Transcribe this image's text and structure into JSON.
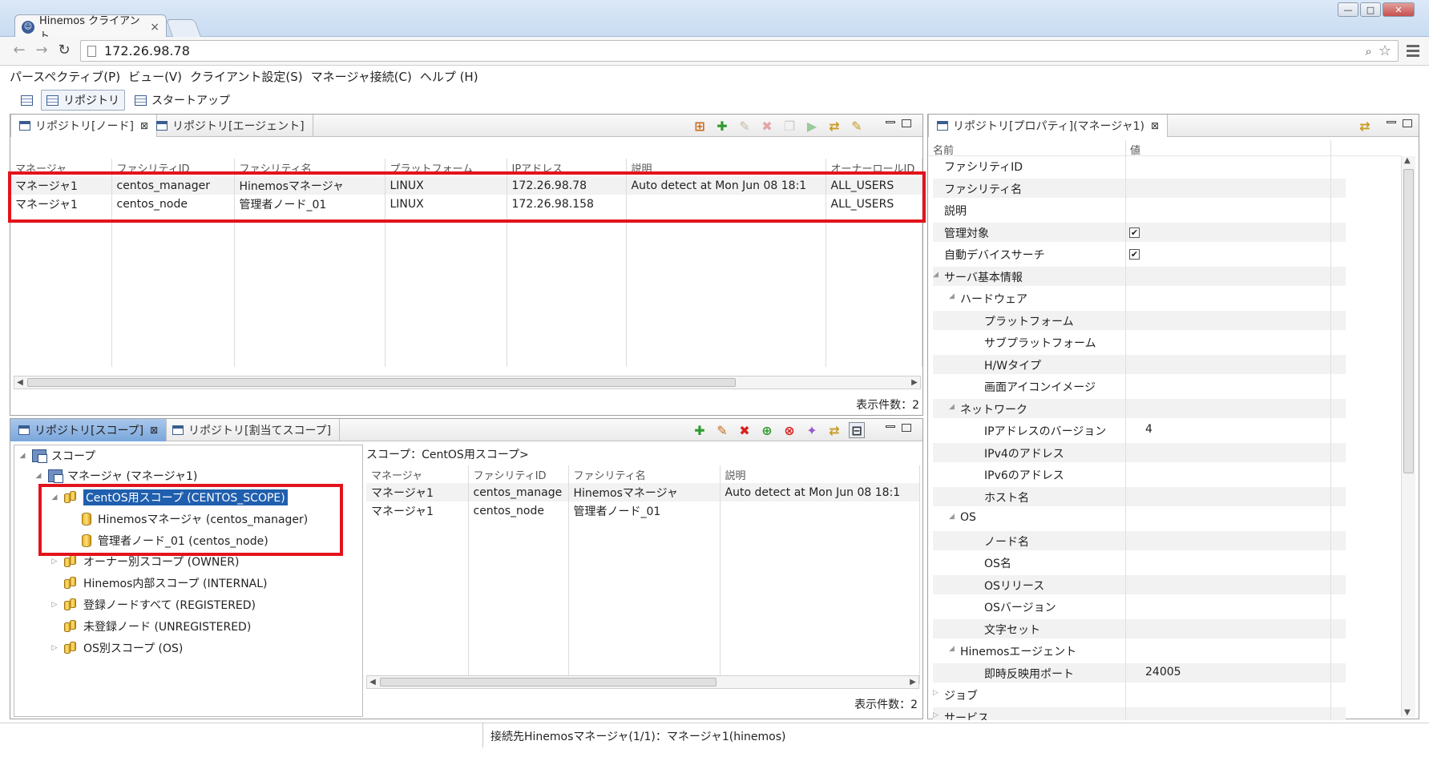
{
  "browser": {
    "tab_title": "Hinemos クライアント",
    "tab_close": "×",
    "url": "172.26.98.78",
    "window_buttons": [
      "—",
      "□",
      "✕"
    ]
  },
  "menu": [
    "パースペクティブ(P)",
    "ビュー(V)",
    "クライアント設定(S)",
    "マネージャ接続(C)",
    "ヘルプ (H)"
  ],
  "perspectives": {
    "items": [
      "リポジトリ",
      "スタートアップ"
    ]
  },
  "node_view": {
    "tabs": [
      "リポジトリ[ノード]",
      "リポジトリ[エージェント]"
    ],
    "columns": [
      "マネージャ",
      "ファシリティID",
      "ファシリティ名",
      "プラットフォーム",
      "IPアドレス",
      "説明",
      "オーナーロールID"
    ],
    "rows": [
      [
        "マネージャ1",
        "centos_manager",
        "Hinemosマネージャ",
        "LINUX",
        "172.26.98.78",
        "Auto detect at Mon Jun 08 18:1",
        "ALL_USERS"
      ],
      [
        "マネージャ1",
        "centos_node",
        "管理者ノード_01",
        "LINUX",
        "172.26.98.158",
        "",
        "ALL_USERS"
      ]
    ],
    "count_label": "表示件数：2"
  },
  "scope_view": {
    "tabs": [
      "リポジトリ[スコープ]",
      "リポジトリ[割当てスコープ]"
    ],
    "tree": {
      "root": "スコープ",
      "manager": "マネージャ (マネージャ1)",
      "selected": "CentOS用スコープ (CENTOS_SCOPE)",
      "children": [
        "Hinemosマネージャ (centos_manager)",
        "管理者ノード_01 (centos_node)"
      ],
      "others": [
        "オーナー別スコープ (OWNER)",
        "Hinemos内部スコープ (INTERNAL)",
        "登録ノードすべて (REGISTERED)",
        "未登録ノード (UNREGISTERED)",
        "OS別スコープ (OS)"
      ]
    },
    "detail_title": "スコープ：CentOS用スコープ>",
    "columns": [
      "マネージャ",
      "ファシリティID",
      "ファシリティ名",
      "説明"
    ],
    "rows": [
      [
        "マネージャ1",
        "centos_manage",
        "Hinemosマネージャ",
        "Auto detect at Mon Jun 08 18:1"
      ],
      [
        "マネージャ1",
        "centos_node",
        "管理者ノード_01",
        ""
      ]
    ],
    "count_label": "表示件数：2"
  },
  "property_view": {
    "tab": "リポジトリ[プロパティ](マネージャ1)",
    "col_name": "名前",
    "col_value": "値",
    "rows": [
      {
        "name": "ファシリティID",
        "value": "",
        "indent": 0
      },
      {
        "name": "ファシリティ名",
        "value": "",
        "indent": 0
      },
      {
        "name": "説明",
        "value": "",
        "indent": 0
      },
      {
        "name": "管理対象",
        "value": "✔",
        "indent": 0,
        "check": true
      },
      {
        "name": "自動デバイスサーチ",
        "value": "✔",
        "indent": 0,
        "check": true
      },
      {
        "name": "サーバ基本情報",
        "value": "",
        "indent": 0,
        "expand": true
      },
      {
        "name": "ハードウェア",
        "value": "",
        "indent": 1,
        "expand": true
      },
      {
        "name": "プラットフォーム",
        "value": "",
        "indent": 2
      },
      {
        "name": "サブプラットフォーム",
        "value": "",
        "indent": 2
      },
      {
        "name": "H/Wタイプ",
        "value": "",
        "indent": 2
      },
      {
        "name": "画面アイコンイメージ",
        "value": "",
        "indent": 2
      },
      {
        "name": "ネットワーク",
        "value": "",
        "indent": 1,
        "expand": true
      },
      {
        "name": "IPアドレスのバージョン",
        "value": "4",
        "indent": 2
      },
      {
        "name": "IPv4のアドレス",
        "value": "",
        "indent": 2
      },
      {
        "name": "IPv6のアドレス",
        "value": "",
        "indent": 2
      },
      {
        "name": "ホスト名",
        "value": "",
        "indent": 2
      },
      {
        "name": "OS",
        "value": "",
        "indent": 1,
        "expand": true
      },
      {
        "name": "ノード名",
        "value": "",
        "indent": 2
      },
      {
        "name": "OS名",
        "value": "",
        "indent": 2
      },
      {
        "name": "OSリリース",
        "value": "",
        "indent": 2
      },
      {
        "name": "OSバージョン",
        "value": "",
        "indent": 2
      },
      {
        "name": "文字セット",
        "value": "",
        "indent": 2
      },
      {
        "name": "Hinemosエージェント",
        "value": "",
        "indent": 1,
        "expand": true
      },
      {
        "name": "即時反映用ポート",
        "value": "24005",
        "indent": 2
      },
      {
        "name": "ジョブ",
        "value": "",
        "indent": 0,
        "collapsed": true
      },
      {
        "name": "サービス",
        "value": "",
        "indent": 0,
        "collapsed": true
      }
    ]
  },
  "status_bar": "接続先Hinemosマネージャ(1/1)：マネージャ1(hinemos)",
  "colors": {
    "highlight_box": "#e3131c",
    "selection": "#1f5fae",
    "active_tab": "#7aa6dc"
  }
}
